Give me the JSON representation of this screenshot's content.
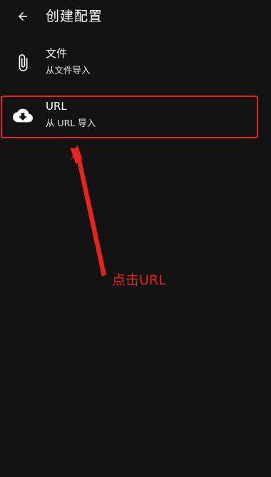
{
  "header": {
    "title": "创建配置",
    "back_icon": "arrow-left-icon"
  },
  "items": [
    {
      "title": "文件",
      "subtitle": "从文件导入",
      "icon": "paperclip-icon"
    },
    {
      "title": "URL",
      "subtitle": "从 URL 导入",
      "icon": "cloud-download-icon"
    }
  ],
  "annotation": {
    "text": "点击URL",
    "color": "#e8231e"
  },
  "colors": {
    "background": "#121212",
    "text": "#ffffff",
    "annotation": "#e8231e"
  }
}
